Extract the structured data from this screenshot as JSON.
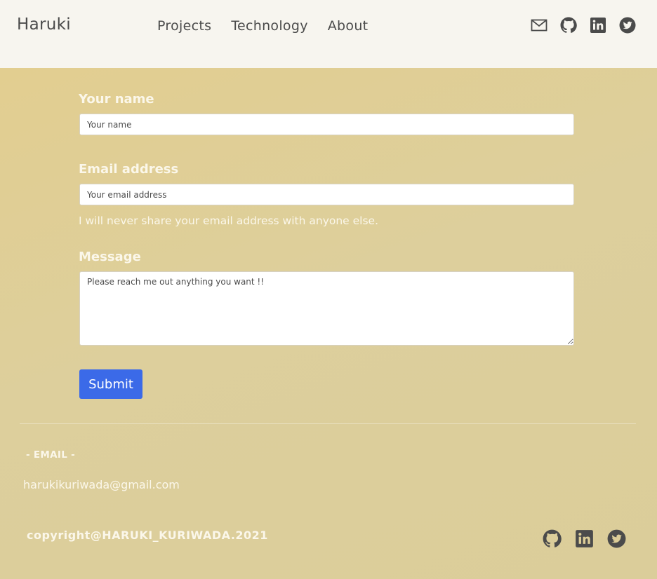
{
  "header": {
    "brand": "Haruki",
    "nav": [
      "Projects",
      "Technology",
      "About"
    ],
    "icons": [
      "mail-icon",
      "github-icon",
      "linkedin-icon",
      "twitter-icon"
    ]
  },
  "form": {
    "name_label": "Your name",
    "name_placeholder": "Your name",
    "email_label": "Email address",
    "email_placeholder": "Your email address",
    "email_help": "I will never share your email address with anyone else.",
    "message_label": "Message",
    "message_placeholder": "Please reach me out anything you want !!",
    "submit_label": "Submit"
  },
  "footer": {
    "email_heading": "- EMAIL -",
    "email": "harukikuriwada@gmail.com",
    "copyright": "copyright@HARUKI_KURIWADA.2021",
    "icons": [
      "github-icon",
      "linkedin-icon",
      "twitter-icon"
    ]
  },
  "colors": {
    "header_bg": "#f7f5ef",
    "main_bg": "#e2ce90",
    "accent_button": "#3b6ae8",
    "icon": "#4b4b4b",
    "light_text": "#fbf7ea"
  }
}
